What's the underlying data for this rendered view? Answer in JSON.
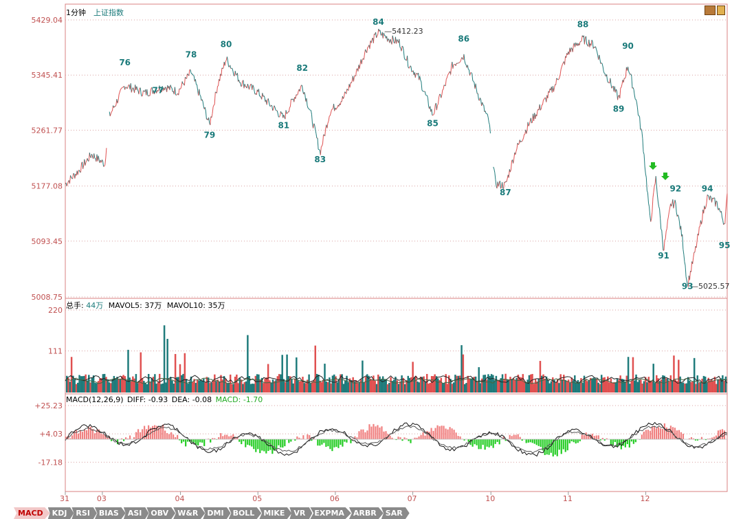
{
  "chart_header": {
    "period": "1分钟",
    "index_name": "上证指数"
  },
  "price_panel": {
    "y_ticks": [
      "5429.04",
      "5345.41",
      "5261.77",
      "5177.08",
      "5093.45",
      "5008.75"
    ],
    "y_tick_values": [
      5429.04,
      5345.41,
      5261.77,
      5177.08,
      5093.45,
      5008.75
    ],
    "high_label": "5412.23",
    "low_label": "5025.57",
    "wave_labels": [
      {
        "label": "76",
        "time": 0.09,
        "price": 5360
      },
      {
        "label": "77",
        "time": 0.14,
        "price": 5318
      },
      {
        "label": "78",
        "time": 0.19,
        "price": 5372
      },
      {
        "label": "79",
        "time": 0.218,
        "price": 5250
      },
      {
        "label": "80",
        "time": 0.243,
        "price": 5388
      },
      {
        "label": "81",
        "time": 0.33,
        "price": 5265
      },
      {
        "label": "82",
        "time": 0.358,
        "price": 5352
      },
      {
        "label": "83",
        "time": 0.385,
        "price": 5213
      },
      {
        "label": "84",
        "time": 0.473,
        "price": 5422
      },
      {
        "label": "85",
        "time": 0.555,
        "price": 5268
      },
      {
        "label": "86",
        "time": 0.602,
        "price": 5396
      },
      {
        "label": "87",
        "time": 0.665,
        "price": 5163
      },
      {
        "label": "88",
        "time": 0.782,
        "price": 5418
      },
      {
        "label": "89",
        "time": 0.836,
        "price": 5290
      },
      {
        "label": "90",
        "time": 0.85,
        "price": 5385
      },
      {
        "label": "91",
        "time": 0.904,
        "price": 5067
      },
      {
        "label": "92",
        "time": 0.922,
        "price": 5169
      },
      {
        "label": "93",
        "time": 0.94,
        "price": 5021
      },
      {
        "label": "94",
        "time": 0.97,
        "price": 5169
      },
      {
        "label": "95",
        "time": 0.996,
        "price": 5083
      }
    ]
  },
  "volume_panel": {
    "legend_total_label": "总手:",
    "legend_total_value": "44万",
    "legend_mavol5": "MAVOL5: 37万",
    "legend_mavol10": "MAVOL10: 35万",
    "y_ticks": [
      "220",
      "111"
    ],
    "y_tick_values": [
      220,
      111
    ]
  },
  "macd_panel": {
    "legend_name": "MACD(12,26,9)",
    "legend_diff": "DIFF: -0.93",
    "legend_dea": "DEA: -0.08",
    "legend_macd": "MACD: -1.70",
    "y_ticks": [
      "+25.23",
      "+4.03",
      "-17.18"
    ],
    "y_tick_values": [
      25.23,
      4.03,
      -17.18
    ]
  },
  "x_axis_labels": [
    "31",
    "03",
    "04",
    "05",
    "06",
    "07",
    "10",
    "11",
    "12"
  ],
  "indicator_tabs": [
    "MACD",
    "KDJ",
    "RSI",
    "BIAS",
    "ASI",
    "OBV",
    "W&R",
    "DMI",
    "BOLL",
    "MIKE",
    "VR",
    "EXPMA",
    "ARBR",
    "SAR"
  ],
  "active_tab": "MACD",
  "colors": {
    "up": "#e05050",
    "down": "#1e7b7b",
    "macd_pos": "#f08080",
    "macd_neg": "#22cc22",
    "axis_text": "#c05050",
    "grid": "#d8a0a0",
    "wave_label": "#1a7a7a"
  },
  "chart_data": [
    {
      "type": "line",
      "title": "上证指数",
      "ylim": [
        5008.75,
        5429.04
      ],
      "x_days": [
        "31",
        "03",
        "04",
        "05",
        "06",
        "07",
        "10",
        "11",
        "12"
      ],
      "price_series_points": [
        [
          0.0,
          5180
        ],
        [
          0.02,
          5200
        ],
        [
          0.04,
          5225
        ],
        [
          0.06,
          5210
        ],
        [
          0.065,
          5280
        ],
        [
          0.09,
          5330
        ],
        [
          0.12,
          5318
        ],
        [
          0.15,
          5328
        ],
        [
          0.17,
          5320
        ],
        [
          0.19,
          5350
        ],
        [
          0.205,
          5310
        ],
        [
          0.218,
          5270
        ],
        [
          0.23,
          5330
        ],
        [
          0.243,
          5370
        ],
        [
          0.265,
          5335
        ],
        [
          0.29,
          5320
        ],
        [
          0.31,
          5300
        ],
        [
          0.33,
          5280
        ],
        [
          0.345,
          5310
        ],
        [
          0.358,
          5330
        ],
        [
          0.37,
          5290
        ],
        [
          0.385,
          5228
        ],
        [
          0.4,
          5290
        ],
        [
          0.42,
          5310
        ],
        [
          0.44,
          5350
        ],
        [
          0.455,
          5385
        ],
        [
          0.473,
          5410
        ],
        [
          0.49,
          5400
        ],
        [
          0.505,
          5395
        ],
        [
          0.52,
          5360
        ],
        [
          0.535,
          5340
        ],
        [
          0.555,
          5285
        ],
        [
          0.57,
          5320
        ],
        [
          0.585,
          5360
        ],
        [
          0.602,
          5375
        ],
        [
          0.615,
          5340
        ],
        [
          0.63,
          5300
        ],
        [
          0.64,
          5275
        ],
        [
          0.65,
          5180
        ],
        [
          0.665,
          5178
        ],
        [
          0.68,
          5230
        ],
        [
          0.7,
          5270
        ],
        [
          0.72,
          5300
        ],
        [
          0.74,
          5330
        ],
        [
          0.76,
          5380
        ],
        [
          0.782,
          5400
        ],
        [
          0.8,
          5390
        ],
        [
          0.815,
          5350
        ],
        [
          0.836,
          5310
        ],
        [
          0.85,
          5360
        ],
        [
          0.862,
          5310
        ],
        [
          0.872,
          5250
        ],
        [
          0.884,
          5120
        ],
        [
          0.892,
          5190
        ],
        [
          0.904,
          5080
        ],
        [
          0.915,
          5150
        ],
        [
          0.922,
          5150
        ],
        [
          0.932,
          5100
        ],
        [
          0.94,
          5025.57
        ],
        [
          0.952,
          5080
        ],
        [
          0.962,
          5130
        ],
        [
          0.97,
          5160
        ],
        [
          0.985,
          5150
        ],
        [
          0.996,
          5120
        ],
        [
          1.0,
          5160
        ]
      ],
      "high": 5412.23,
      "low": 5025.57
    },
    {
      "type": "bar",
      "title": "总手",
      "ylim": [
        0,
        220
      ],
      "series": [
        {
          "name": "MAVOL5",
          "value_latest": "37万"
        },
        {
          "name": "MAVOL10",
          "value_latest": "35万"
        }
      ]
    },
    {
      "type": "bar",
      "title": "MACD(12,26,9)",
      "ylim": [
        -25,
        25.23
      ],
      "series": [
        {
          "name": "DIFF",
          "value_latest": -0.93
        },
        {
          "name": "DEA",
          "value_latest": -0.08
        },
        {
          "name": "MACD",
          "value_latest": -1.7
        }
      ]
    }
  ]
}
